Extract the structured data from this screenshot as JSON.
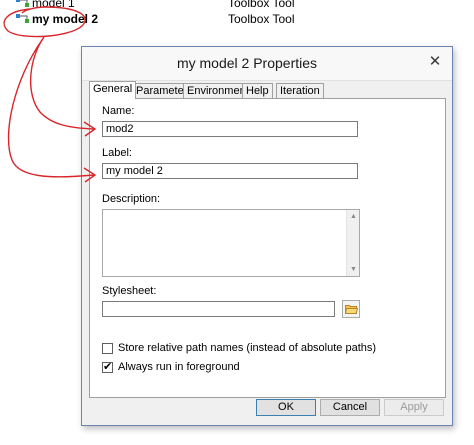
{
  "catalog": {
    "rows": [
      {
        "name": "model 1",
        "type": "Toolbox Tool",
        "icon": "model-icon"
      },
      {
        "name": "my model 2",
        "type": "Toolbox Tool",
        "icon": "model-icon"
      }
    ]
  },
  "dialog": {
    "title": "my model 2 Properties",
    "close_glyph": "✕",
    "tabs": [
      "General",
      "Parameters",
      "Environments",
      "Help",
      "Iteration"
    ],
    "active_tab": "General",
    "fields": {
      "name_label": "Name:",
      "name_value": "mod2",
      "label_label": "Label:",
      "label_value": "my model 2",
      "description_label": "Description:",
      "description_value": "",
      "stylesheet_label": "Stylesheet:",
      "stylesheet_value": ""
    },
    "checkboxes": {
      "relative_paths": {
        "label": "Store relative path names (instead of absolute paths)",
        "checked": false
      },
      "foreground": {
        "label": "Always run in foreground",
        "checked": true
      }
    },
    "buttons": {
      "ok": "OK",
      "cancel": "Cancel",
      "apply": "Apply"
    }
  },
  "colors": {
    "annotation": "#d8262a",
    "dialog_border": "#6b84b1",
    "ok_border": "#3c7fb1"
  }
}
